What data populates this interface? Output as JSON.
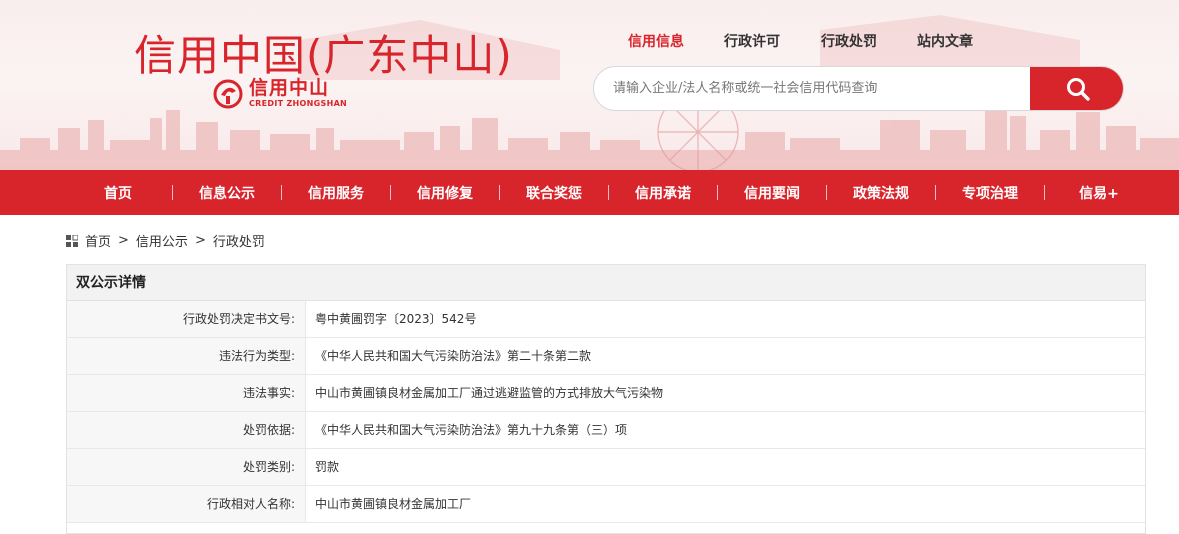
{
  "header": {
    "site_title": "信用中国(广东中山)",
    "logo_cn": "信用中山",
    "logo_en": "CREDIT ZHONGSHAN",
    "top_links": [
      {
        "label": "信用信息",
        "active": true
      },
      {
        "label": "行政许可",
        "active": false
      },
      {
        "label": "行政处罚",
        "active": false
      },
      {
        "label": "站内文章",
        "active": false
      }
    ],
    "search": {
      "placeholder": "请输入企业/法人名称或统一社会信用代码查询",
      "icon": "search-icon"
    }
  },
  "nav": {
    "items": [
      "首页",
      "信息公示",
      "信用服务",
      "信用修复",
      "联合奖惩",
      "信用承诺",
      "信用要闻",
      "政策法规",
      "专项治理",
      "信易+"
    ]
  },
  "breadcrumb": {
    "icon": "grid-icon",
    "items": [
      "首页",
      "信用公示",
      "行政处罚"
    ],
    "separator": ">"
  },
  "detail": {
    "title": "双公示详情",
    "rows": [
      {
        "label": "行政处罚决定书文号:",
        "value": "粤中黄圃罚字〔2023〕542号"
      },
      {
        "label": "违法行为类型:",
        "value": "《中华人民共和国大气污染防治法》第二十条第二款"
      },
      {
        "label": "违法事实:",
        "value": "中山市黄圃镇良材金属加工厂通过逃避监管的方式排放大气污染物"
      },
      {
        "label": "处罚依据:",
        "value": "《中华人民共和国大气污染防治法》第九十九条第（三）项"
      },
      {
        "label": "处罚类别:",
        "value": "罚款"
      },
      {
        "label": "行政相对人名称:",
        "value": "中山市黄圃镇良材金属加工厂"
      }
    ]
  },
  "colors": {
    "brand_red": "#d8252c"
  }
}
